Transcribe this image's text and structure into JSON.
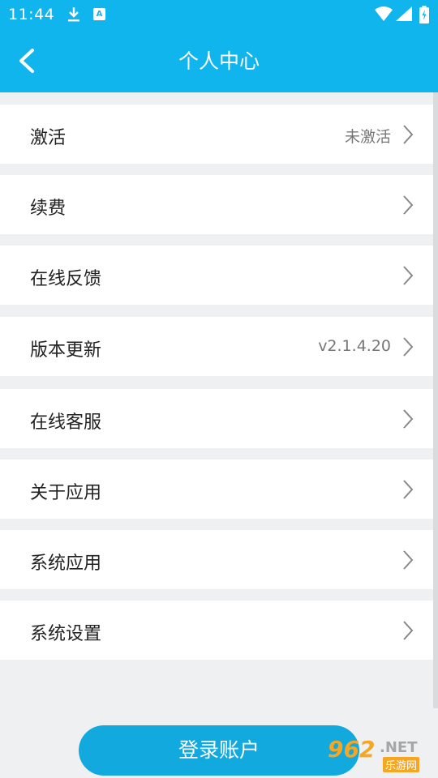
{
  "status_bar": {
    "time": "11:44",
    "icons": [
      "download-icon",
      "a-badge-icon",
      "wifi-icon",
      "signal-icon",
      "battery-icon"
    ],
    "a_badge_letter": "A"
  },
  "header": {
    "title": "个人中心",
    "background": "#10b5ee"
  },
  "menu": {
    "items": [
      {
        "label": "激活",
        "value": "未激活"
      },
      {
        "label": "续费",
        "value": ""
      },
      {
        "label": "在线反馈",
        "value": ""
      },
      {
        "label": "版本更新",
        "value": "v2.1.4.20"
      },
      {
        "label": "在线客服",
        "value": ""
      },
      {
        "label": "关于应用",
        "value": ""
      },
      {
        "label": "系统应用",
        "value": ""
      },
      {
        "label": "系统设置",
        "value": ""
      }
    ]
  },
  "login_button": {
    "label": "登录账户",
    "color": "#12a9de"
  },
  "watermark": {
    "number": "962",
    "domain": ".NET",
    "subtitle": "乐游网"
  }
}
